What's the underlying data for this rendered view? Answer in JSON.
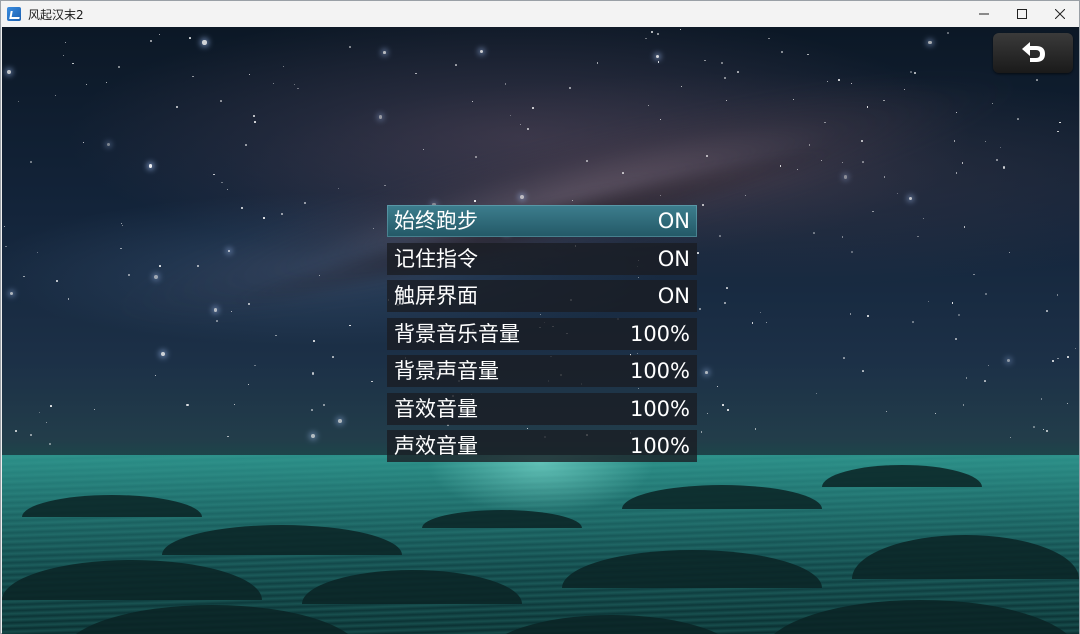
{
  "window": {
    "title": "风起汉末2",
    "icon": "app-icon",
    "controls": [
      "minimize-icon",
      "maximize-icon",
      "close-icon"
    ]
  },
  "back_button": {
    "icon": "back-arrow-icon"
  },
  "options": [
    {
      "label": "始终跑步",
      "value": "ON",
      "selected": true
    },
    {
      "label": "记住指令",
      "value": "ON",
      "selected": false
    },
    {
      "label": "触屏界面",
      "value": "ON",
      "selected": false
    },
    {
      "label": "背景音乐音量",
      "value": "100%",
      "selected": false
    },
    {
      "label": "背景声音量",
      "value": "100%",
      "selected": false
    },
    {
      "label": "音效音量",
      "value": "100%",
      "selected": false
    },
    {
      "label": "声效音量",
      "value": "100%",
      "selected": false
    }
  ],
  "colors": {
    "selected_row": "#2f6f7f",
    "row_background": "#1c1f25",
    "text": "#ffffff"
  }
}
